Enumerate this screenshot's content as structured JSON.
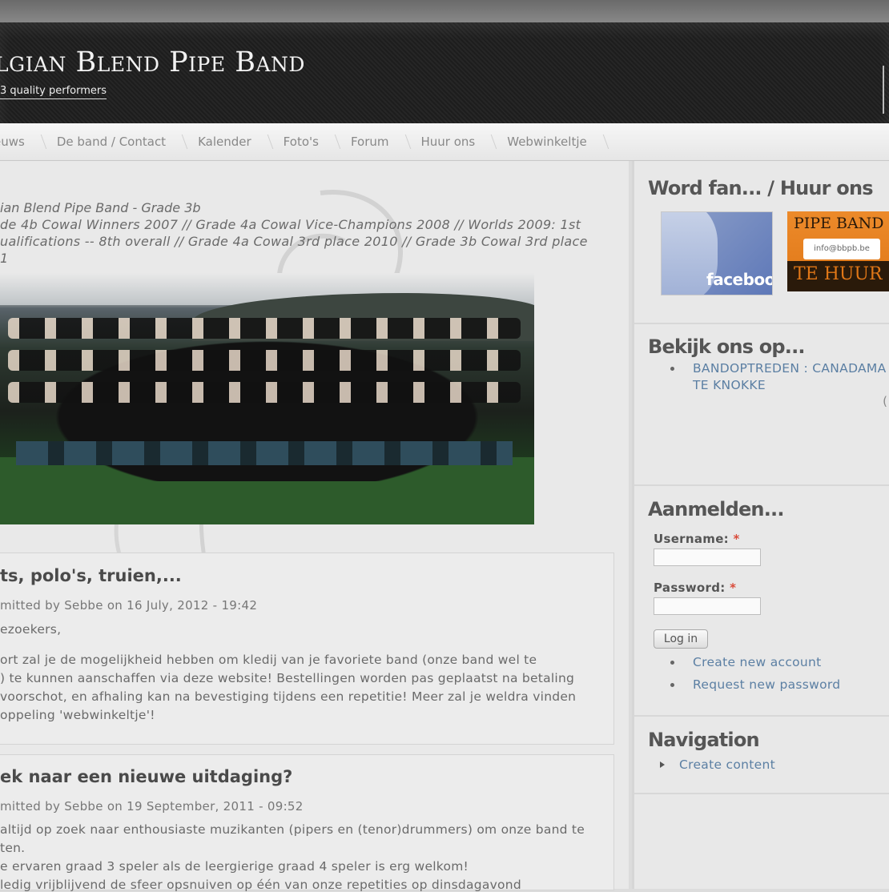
{
  "header": {
    "site_title": "lgian Blend Pipe Band",
    "slogan": "3 quality performers"
  },
  "nav": {
    "items": [
      "euws",
      "De band / Contact",
      "Kalender",
      "Foto's",
      "Forum",
      "Huur ons",
      "Webwinkeltje"
    ]
  },
  "intro": {
    "title": "ian Blend Pipe Band - Grade 3b",
    "lines": [
      "de 4b Cowal Winners 2007 // Grade 4a Cowal Vice-Champions 2008 // Worlds 2009: 1st",
      "ualifications -- 8th overall // Grade 4a Cowal 3rd place 2010 // Grade 3b Cowal 3rd place",
      "1"
    ]
  },
  "posts": [
    {
      "title": "ts, polo's, truien,...",
      "meta": "mitted by Sebbe on 16 July, 2012 - 19:42",
      "lines": [
        "ezoekers,",
        "ort zal je de mogelijkheid hebben om kledij van je favoriete band (onze band wel te",
        ") te kunnen aanschaffen via deze website! Bestellingen worden pas geplaatst na betaling",
        " voorschot, en afhaling kan na bevestiging tijdens een repetitie! Meer zal je weldra vinden",
        "oppeling 'webwinkeltje'!"
      ]
    },
    {
      "title": "ek naar een nieuwe uitdaging?",
      "meta": "mitted by Sebbe on 19 September, 2011 - 09:52",
      "lines": [
        "altijd op zoek naar enthousiaste muzikanten (pipers en (tenor)drummers) om onze band te",
        "ten.",
        "e ervaren graad 3 speler als de leergierige graad 4 speler is erg welkom!",
        "ledig vrijblijvend de sfeer opsnuiven op één van onze repetities op dinsdagavond"
      ]
    }
  ],
  "sidebar": {
    "fan": {
      "title": "Word fan... / Huur ons",
      "facebook_label": "facebook",
      "hire_top": "PIPE BAND",
      "hire_mail": "info@bbpb.be",
      "hire_bottom": "TE HUUR"
    },
    "watch": {
      "title": "Bekijk ons op...",
      "link_line1": "BANDOPTREDEN : CANADAMA",
      "link_line2": "TE KNOKKE",
      "edge_char": "("
    },
    "login": {
      "title": "Aanmelden...",
      "username_label": "Username:",
      "password_label": "Password:",
      "required_mark": "*",
      "button": "Log in",
      "links": [
        "Create new account",
        "Request new password"
      ]
    },
    "navigation": {
      "title": "Navigation",
      "links": [
        "Create content"
      ]
    }
  }
}
